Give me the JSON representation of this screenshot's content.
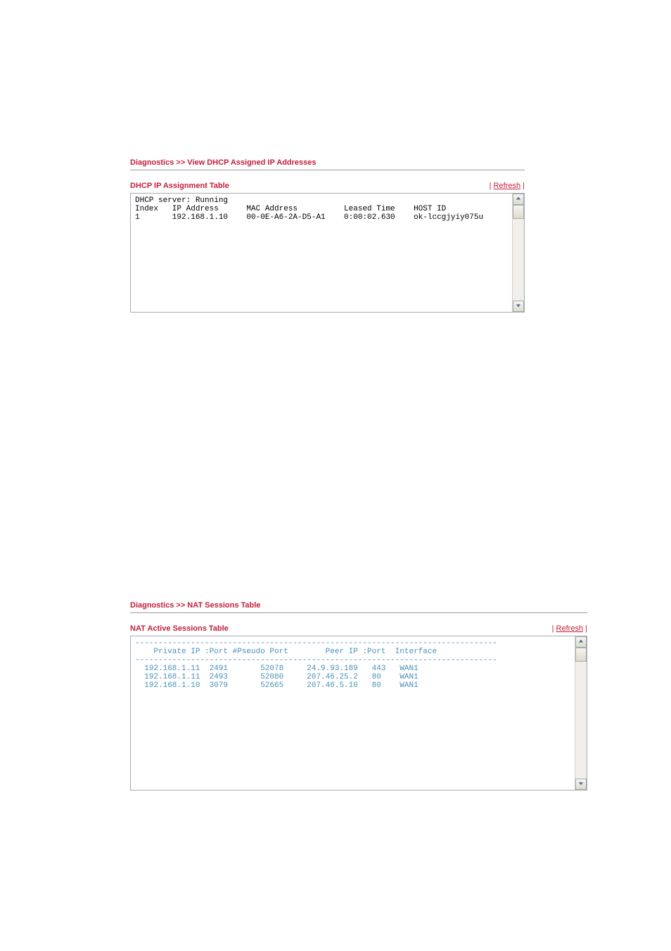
{
  "section1": {
    "breadcrumb": "Diagnostics >> View DHCP Assigned IP Addresses",
    "title": "DHCP IP Assignment Table",
    "refresh_label": "Refresh",
    "content": {
      "status_line": "DHCP server: Running",
      "columns": [
        "Index",
        "IP Address",
        "MAC Address",
        "Leased Time",
        "HOST ID"
      ],
      "rows": [
        {
          "index": "1",
          "ip": "192.168.1.10",
          "mac": "00-0E-A6-2A-D5-A1",
          "leased": "0:00:02.630",
          "host": "ok-lccgjyiy075u"
        }
      ]
    }
  },
  "section2": {
    "breadcrumb": "Diagnostics >> NAT Sessions Table",
    "title": "NAT Active Sessions Table",
    "refresh_label": "Refresh",
    "content": {
      "columns": [
        "Private IP",
        ":Port",
        "#Pseudo Port",
        "Peer IP",
        ":Port",
        "Interface"
      ],
      "rows": [
        {
          "private_ip": "192.168.1.11",
          "port": "2491",
          "pseudo": "52078",
          "peer_ip": "24.9.93.189",
          "peer_port": "443",
          "iface": "WAN1"
        },
        {
          "private_ip": "192.168.1.11",
          "port": "2493",
          "pseudo": "52080",
          "peer_ip": "207.46.25.2",
          "peer_port": "80",
          "iface": "WAN1"
        },
        {
          "private_ip": "192.168.1.10",
          "port": "3079",
          "pseudo": "52665",
          "peer_ip": "207.46.5.10",
          "peer_port": "80",
          "iface": "WAN1"
        }
      ]
    }
  }
}
